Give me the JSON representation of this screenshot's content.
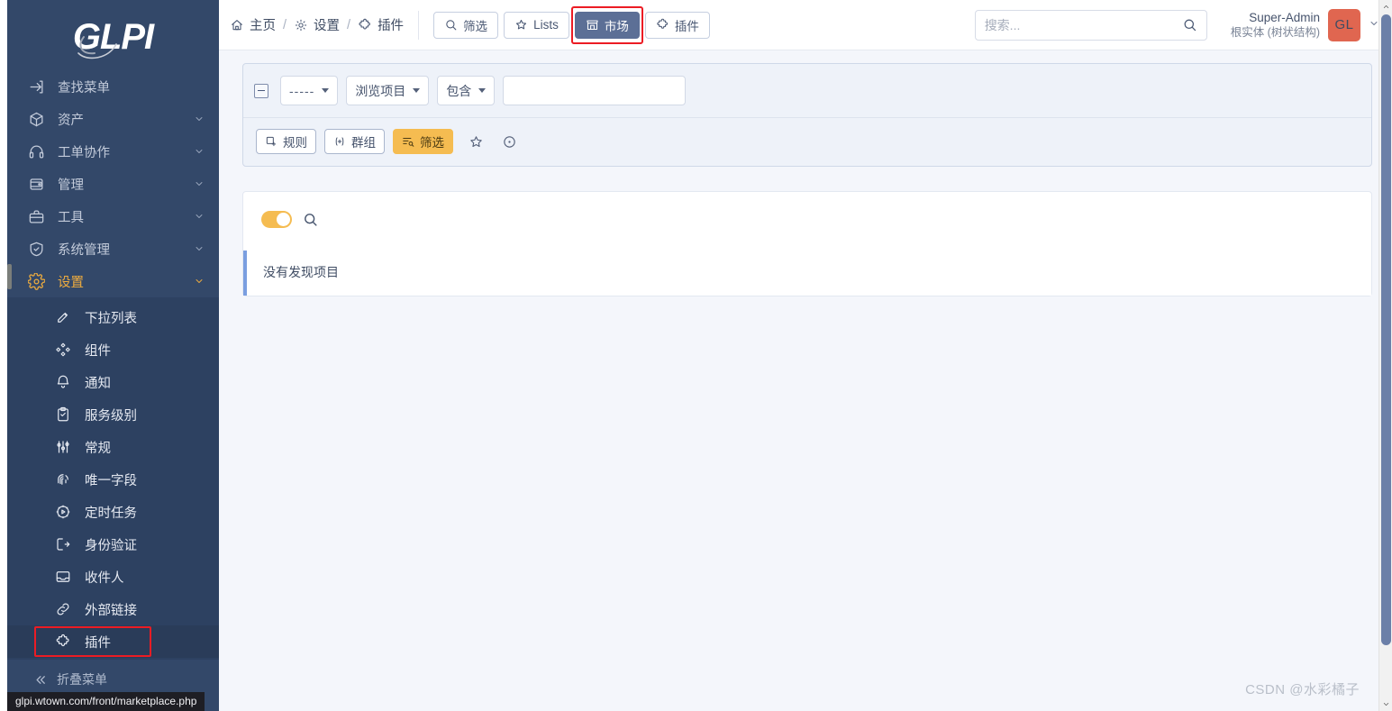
{
  "brand": {
    "logo_text": "GLPI"
  },
  "colors": {
    "sidebar_bg": "#334869",
    "sidebar_submenu_bg": "#2d4161",
    "accent_orange": "#f0ad3e",
    "annotation_red": "#ec1c24",
    "active_button_bg": "#5c6f96",
    "avatar_bg": "#e06650",
    "alert_border": "#7a9ee0"
  },
  "sidebar": {
    "items": [
      {
        "label": "查找菜单",
        "icon": "arrow-right-square-icon",
        "has_chevron": false,
        "active": false
      },
      {
        "label": "资产",
        "icon": "package-icon",
        "has_chevron": true,
        "active": false
      },
      {
        "label": "工单协作",
        "icon": "headset-icon",
        "has_chevron": true,
        "active": false
      },
      {
        "label": "管理",
        "icon": "wallet-icon",
        "has_chevron": true,
        "active": false
      },
      {
        "label": "工具",
        "icon": "briefcase-icon",
        "has_chevron": true,
        "active": false
      },
      {
        "label": "系统管理",
        "icon": "shield-check-icon",
        "has_chevron": true,
        "active": false
      },
      {
        "label": "设置",
        "icon": "gear-icon",
        "has_chevron": true,
        "active": true
      }
    ],
    "submenu": [
      {
        "label": "下拉列表",
        "icon": "pencil-square-icon",
        "highlighted": false
      },
      {
        "label": "组件",
        "icon": "components-icon",
        "highlighted": false
      },
      {
        "label": "通知",
        "icon": "bell-icon",
        "highlighted": false
      },
      {
        "label": "服务级别",
        "icon": "clipboard-icon",
        "highlighted": false
      },
      {
        "label": "常规",
        "icon": "sliders-icon",
        "highlighted": false
      },
      {
        "label": "唯一字段",
        "icon": "fingerprint-icon",
        "highlighted": false
      },
      {
        "label": "定时任务",
        "icon": "gear-play-icon",
        "highlighted": false
      },
      {
        "label": "身份验证",
        "icon": "login-icon",
        "highlighted": false
      },
      {
        "label": "收件人",
        "icon": "inbox-icon",
        "highlighted": false
      },
      {
        "label": "外部链接",
        "icon": "link-icon",
        "highlighted": false
      },
      {
        "label": "插件",
        "icon": "puzzle-icon",
        "highlighted": true
      }
    ],
    "collapse": {
      "label": "折叠菜单",
      "icon": "chevrons-left-icon"
    }
  },
  "status_bar": {
    "url": "glpi.wtown.com/front/marketplace.php"
  },
  "topbar": {
    "breadcrumb": [
      {
        "label": "主页",
        "icon": "home-icon"
      },
      {
        "label": "设置",
        "icon": "gear-icon"
      },
      {
        "label": "插件",
        "icon": "puzzle-icon"
      }
    ],
    "separator": "/",
    "buttons": [
      {
        "label": "筛选",
        "icon": "search-icon",
        "active": false,
        "annotated": false
      },
      {
        "label": "Lists",
        "icon": "star-icon",
        "active": false,
        "annotated": false
      },
      {
        "label": "市场",
        "icon": "store-icon",
        "active": true,
        "annotated": true
      },
      {
        "label": "插件",
        "icon": "puzzle-icon",
        "active": false,
        "annotated": false
      }
    ],
    "search": {
      "placeholder": "搜索...",
      "value": "",
      "icon": "search-icon"
    },
    "user": {
      "name": "Super-Admin",
      "entity": "根实体 (树状结构)",
      "avatar_initials": "GL",
      "chevron": "chevron-down-icon"
    }
  },
  "filter_panel": {
    "collapse_toggle": "minus-square-icon",
    "selects": [
      {
        "name": "logic-select",
        "value": "-----"
      },
      {
        "name": "field-select",
        "value": "浏览项目"
      },
      {
        "name": "operator-select",
        "value": "包含"
      }
    ],
    "text_input": {
      "value": "",
      "placeholder": ""
    },
    "actions": [
      {
        "label": "规则",
        "icon": "square-plus-icon",
        "variant": "default"
      },
      {
        "label": "群组",
        "icon": "parenthesis-plus-icon",
        "variant": "default"
      },
      {
        "label": "筛选",
        "icon": "filter-search-icon",
        "variant": "warning"
      }
    ],
    "icon_actions": [
      {
        "name": "favorite-star-icon"
      },
      {
        "name": "reset-circle-icon"
      }
    ]
  },
  "result_panel": {
    "toggle": {
      "name": "view-mode-toggle",
      "state": "on"
    },
    "search_icon": "search-icon",
    "empty_message": "没有发现项目"
  },
  "watermark": {
    "text": "CSDN @水彩橘子"
  }
}
